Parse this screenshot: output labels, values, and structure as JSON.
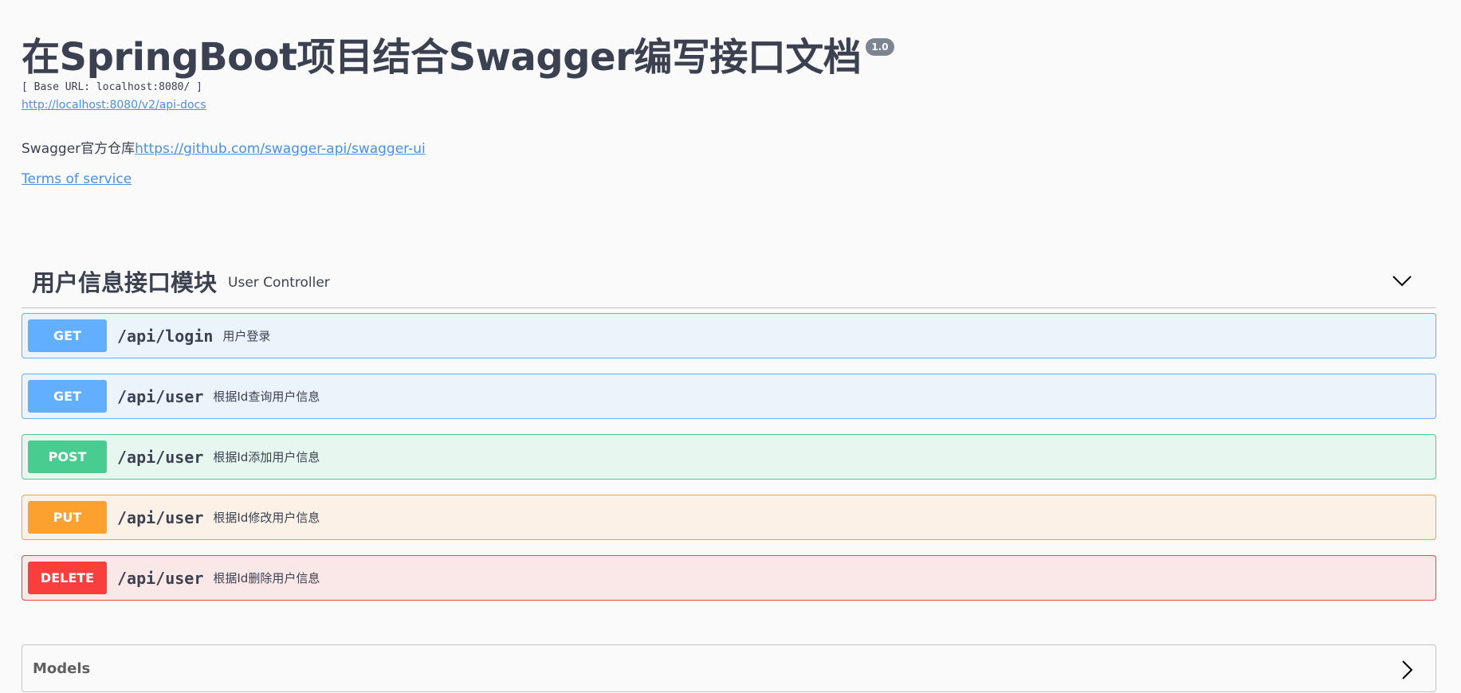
{
  "info": {
    "title": "在SpringBoot项目结合Swagger编写接口文档",
    "version": "1.0",
    "base_url": "[ Base URL: localhost:8080/ ]",
    "spec_link": "http://localhost:8080/v2/api-docs",
    "description_text": "Swagger官方仓库",
    "description_link": "https://github.com/swagger-api/swagger-ui",
    "terms_of_service": "Terms of service"
  },
  "tag": {
    "name": "用户信息接口模块",
    "description": "User Controller",
    "chevron_icon": "chevron-down-icon"
  },
  "operations": [
    {
      "method": "GET",
      "path": "/api/login",
      "summary": "用户登录"
    },
    {
      "method": "GET",
      "path": "/api/user",
      "summary": "根据Id查询用户信息"
    },
    {
      "method": "POST",
      "path": "/api/user",
      "summary": "根据Id添加用户信息"
    },
    {
      "method": "PUT",
      "path": "/api/user",
      "summary": "根据Id修改用户信息"
    },
    {
      "method": "DELETE",
      "path": "/api/user",
      "summary": "根据Id删除用户信息"
    }
  ],
  "models": {
    "title": "Models",
    "chevron_icon": "chevron-right-icon"
  },
  "colors": {
    "get": "#61affe",
    "post": "#49cc90",
    "put": "#fca130",
    "delete": "#f93e3e",
    "link": "#4990e2",
    "text": "#3b4151"
  }
}
